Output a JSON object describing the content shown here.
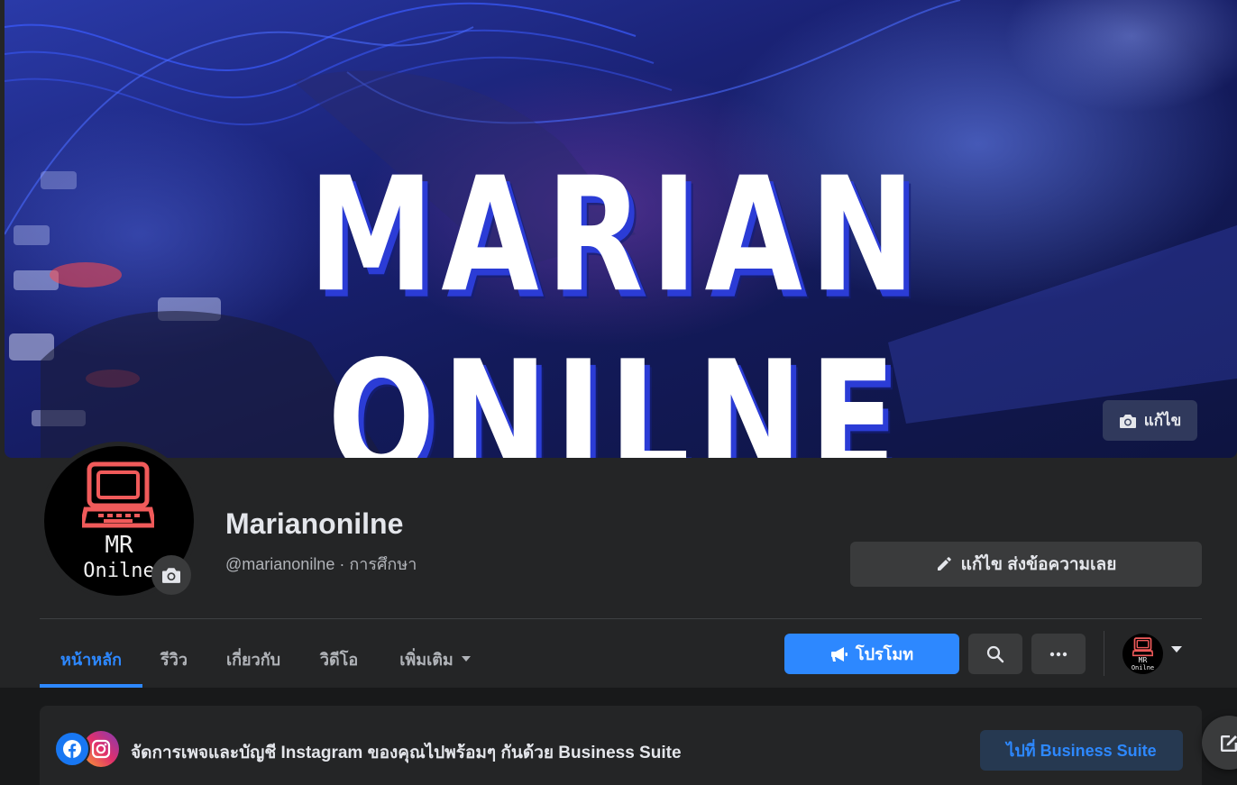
{
  "cover": {
    "title": "MARIAN ONILNE",
    "edit_label": "แก้ไข"
  },
  "avatar": {
    "line1": "MR",
    "line2": "Onilne"
  },
  "profile": {
    "name": "Marianonilne",
    "subtitle": "@marianonilne · การศึกษา"
  },
  "actions": {
    "edit_message_label": "แก้ไข ส่งข้อความเลย"
  },
  "tabs": [
    {
      "label": "หน้าหลัก",
      "active": true
    },
    {
      "label": "รีวิว",
      "active": false
    },
    {
      "label": "เกี่ยวกับ",
      "active": false
    },
    {
      "label": "วิดีโอ",
      "active": false
    },
    {
      "label": "เพิ่มเติม",
      "active": false
    }
  ],
  "toolbar": {
    "promote_label": "โปรโมท",
    "mini_avatar_line1": "MR",
    "mini_avatar_line2": "Onilne"
  },
  "business_suite": {
    "text": "จัดการเพจและบัญชี Instagram ของคุณไปพร้อมๆ กันด้วย Business Suite",
    "button_label": "ไปที่ Business Suite"
  },
  "icons": [
    "camera-icon",
    "pencil-icon",
    "megaphone-icon",
    "search-icon",
    "more-icon",
    "caret-down-icon",
    "facebook-icon",
    "instagram-icon",
    "compose-icon"
  ],
  "colors": {
    "accent": "#2d88ff",
    "surface": "#242526",
    "button": "#3a3b3c",
    "background": "#18191a"
  }
}
